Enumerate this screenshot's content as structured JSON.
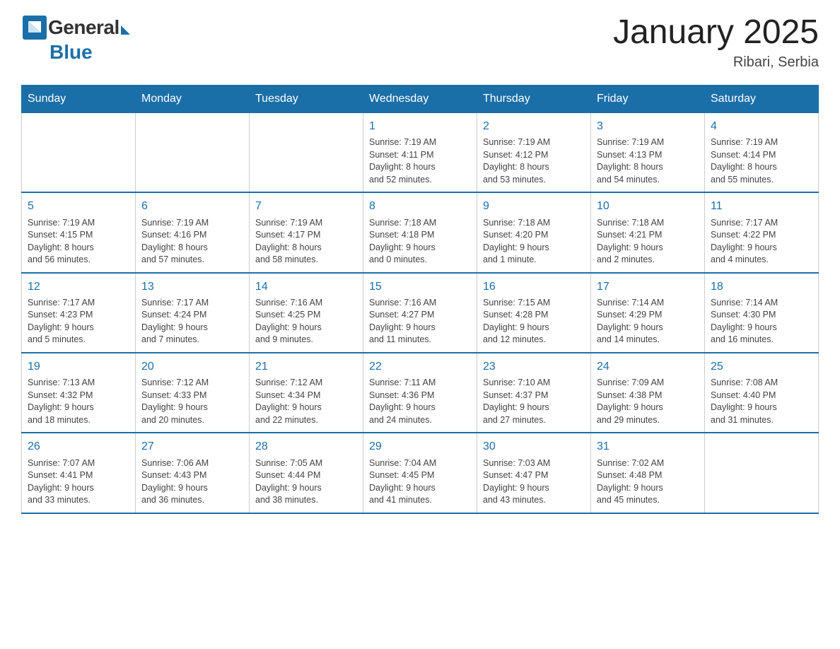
{
  "header": {
    "logo_general": "General",
    "logo_blue": "Blue",
    "month_title": "January 2025",
    "location": "Ribari, Serbia"
  },
  "days_of_week": [
    "Sunday",
    "Monday",
    "Tuesday",
    "Wednesday",
    "Thursday",
    "Friday",
    "Saturday"
  ],
  "weeks": [
    [
      {
        "day": "",
        "info": ""
      },
      {
        "day": "",
        "info": ""
      },
      {
        "day": "",
        "info": ""
      },
      {
        "day": "1",
        "info": "Sunrise: 7:19 AM\nSunset: 4:11 PM\nDaylight: 8 hours\nand 52 minutes."
      },
      {
        "day": "2",
        "info": "Sunrise: 7:19 AM\nSunset: 4:12 PM\nDaylight: 8 hours\nand 53 minutes."
      },
      {
        "day": "3",
        "info": "Sunrise: 7:19 AM\nSunset: 4:13 PM\nDaylight: 8 hours\nand 54 minutes."
      },
      {
        "day": "4",
        "info": "Sunrise: 7:19 AM\nSunset: 4:14 PM\nDaylight: 8 hours\nand 55 minutes."
      }
    ],
    [
      {
        "day": "5",
        "info": "Sunrise: 7:19 AM\nSunset: 4:15 PM\nDaylight: 8 hours\nand 56 minutes."
      },
      {
        "day": "6",
        "info": "Sunrise: 7:19 AM\nSunset: 4:16 PM\nDaylight: 8 hours\nand 57 minutes."
      },
      {
        "day": "7",
        "info": "Sunrise: 7:19 AM\nSunset: 4:17 PM\nDaylight: 8 hours\nand 58 minutes."
      },
      {
        "day": "8",
        "info": "Sunrise: 7:18 AM\nSunset: 4:18 PM\nDaylight: 9 hours\nand 0 minutes."
      },
      {
        "day": "9",
        "info": "Sunrise: 7:18 AM\nSunset: 4:20 PM\nDaylight: 9 hours\nand 1 minute."
      },
      {
        "day": "10",
        "info": "Sunrise: 7:18 AM\nSunset: 4:21 PM\nDaylight: 9 hours\nand 2 minutes."
      },
      {
        "day": "11",
        "info": "Sunrise: 7:17 AM\nSunset: 4:22 PM\nDaylight: 9 hours\nand 4 minutes."
      }
    ],
    [
      {
        "day": "12",
        "info": "Sunrise: 7:17 AM\nSunset: 4:23 PM\nDaylight: 9 hours\nand 5 minutes."
      },
      {
        "day": "13",
        "info": "Sunrise: 7:17 AM\nSunset: 4:24 PM\nDaylight: 9 hours\nand 7 minutes."
      },
      {
        "day": "14",
        "info": "Sunrise: 7:16 AM\nSunset: 4:25 PM\nDaylight: 9 hours\nand 9 minutes."
      },
      {
        "day": "15",
        "info": "Sunrise: 7:16 AM\nSunset: 4:27 PM\nDaylight: 9 hours\nand 11 minutes."
      },
      {
        "day": "16",
        "info": "Sunrise: 7:15 AM\nSunset: 4:28 PM\nDaylight: 9 hours\nand 12 minutes."
      },
      {
        "day": "17",
        "info": "Sunrise: 7:14 AM\nSunset: 4:29 PM\nDaylight: 9 hours\nand 14 minutes."
      },
      {
        "day": "18",
        "info": "Sunrise: 7:14 AM\nSunset: 4:30 PM\nDaylight: 9 hours\nand 16 minutes."
      }
    ],
    [
      {
        "day": "19",
        "info": "Sunrise: 7:13 AM\nSunset: 4:32 PM\nDaylight: 9 hours\nand 18 minutes."
      },
      {
        "day": "20",
        "info": "Sunrise: 7:12 AM\nSunset: 4:33 PM\nDaylight: 9 hours\nand 20 minutes."
      },
      {
        "day": "21",
        "info": "Sunrise: 7:12 AM\nSunset: 4:34 PM\nDaylight: 9 hours\nand 22 minutes."
      },
      {
        "day": "22",
        "info": "Sunrise: 7:11 AM\nSunset: 4:36 PM\nDaylight: 9 hours\nand 24 minutes."
      },
      {
        "day": "23",
        "info": "Sunrise: 7:10 AM\nSunset: 4:37 PM\nDaylight: 9 hours\nand 27 minutes."
      },
      {
        "day": "24",
        "info": "Sunrise: 7:09 AM\nSunset: 4:38 PM\nDaylight: 9 hours\nand 29 minutes."
      },
      {
        "day": "25",
        "info": "Sunrise: 7:08 AM\nSunset: 4:40 PM\nDaylight: 9 hours\nand 31 minutes."
      }
    ],
    [
      {
        "day": "26",
        "info": "Sunrise: 7:07 AM\nSunset: 4:41 PM\nDaylight: 9 hours\nand 33 minutes."
      },
      {
        "day": "27",
        "info": "Sunrise: 7:06 AM\nSunset: 4:43 PM\nDaylight: 9 hours\nand 36 minutes."
      },
      {
        "day": "28",
        "info": "Sunrise: 7:05 AM\nSunset: 4:44 PM\nDaylight: 9 hours\nand 38 minutes."
      },
      {
        "day": "29",
        "info": "Sunrise: 7:04 AM\nSunset: 4:45 PM\nDaylight: 9 hours\nand 41 minutes."
      },
      {
        "day": "30",
        "info": "Sunrise: 7:03 AM\nSunset: 4:47 PM\nDaylight: 9 hours\nand 43 minutes."
      },
      {
        "day": "31",
        "info": "Sunrise: 7:02 AM\nSunset: 4:48 PM\nDaylight: 9 hours\nand 45 minutes."
      },
      {
        "day": "",
        "info": ""
      }
    ]
  ]
}
